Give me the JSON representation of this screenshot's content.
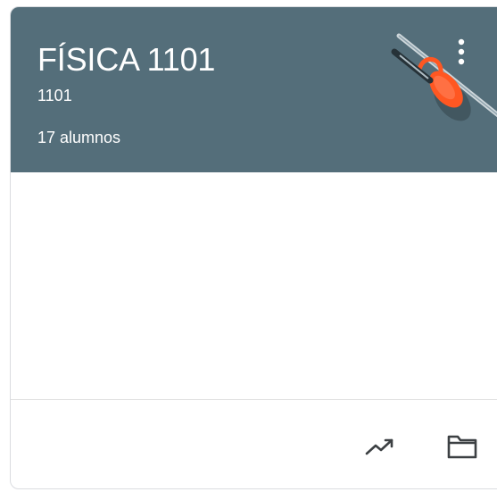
{
  "course": {
    "title": "FÍSICA 1101",
    "section": "1101",
    "students": "17 alumnos"
  },
  "icons": {
    "more": "more-vert-icon",
    "illustration": "fencing-sword-icon",
    "gradebook": "trending-up-icon",
    "drive_folder": "folder-icon"
  },
  "colors": {
    "header_bg": "#546e7a",
    "accent": "#ff5722",
    "icon_gray": "#3c4043"
  }
}
